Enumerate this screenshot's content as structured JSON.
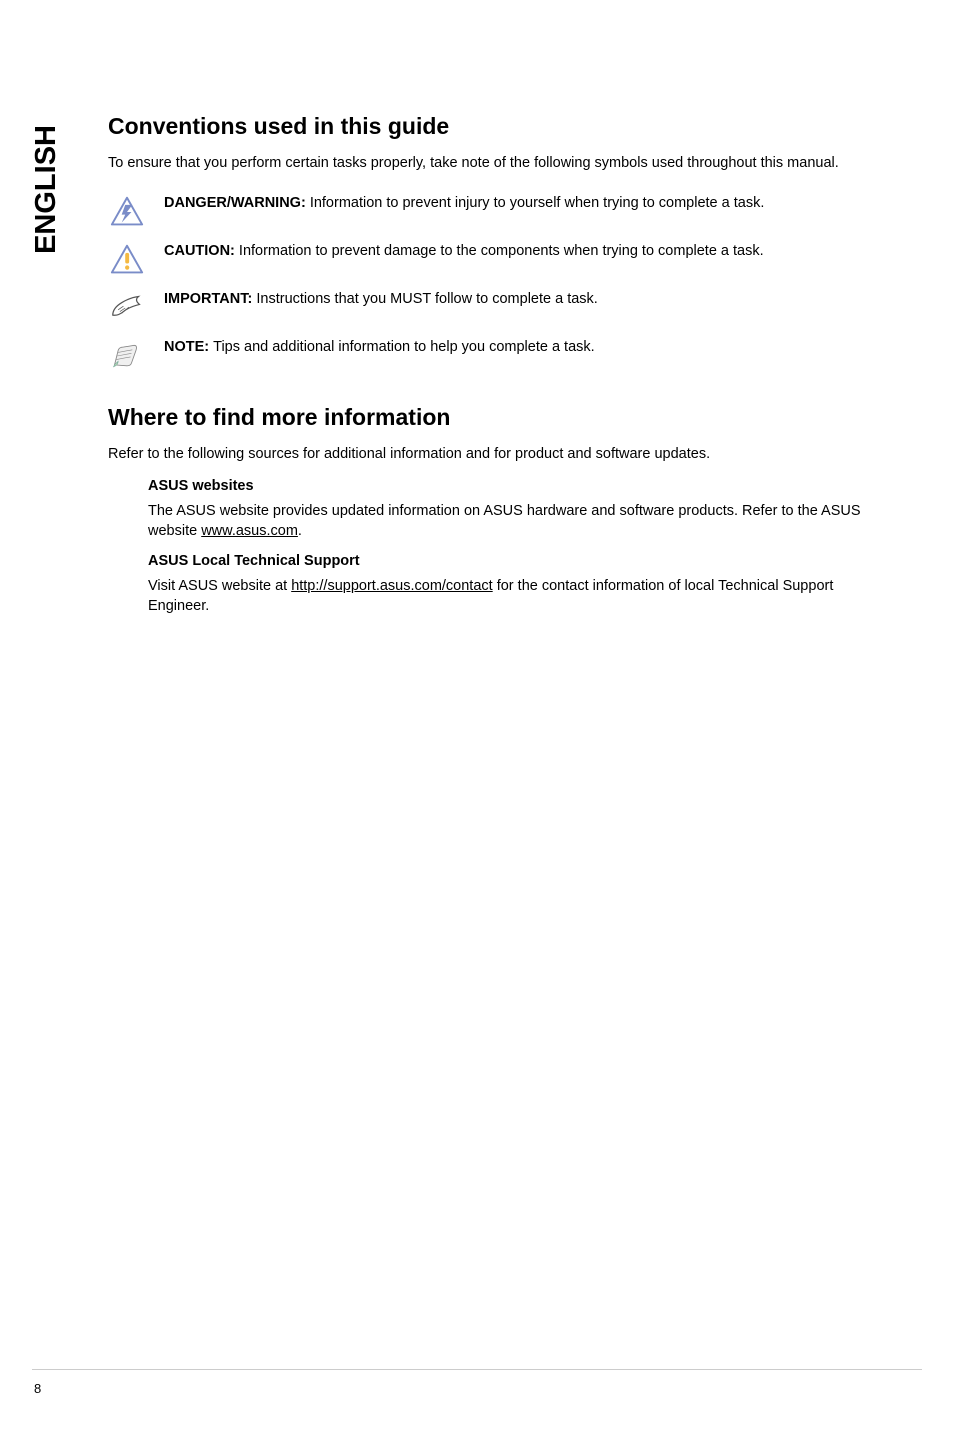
{
  "sidebar": {
    "language": "ENGLISH"
  },
  "section1": {
    "heading": "Conventions used in this guide",
    "intro": "To ensure that you perform certain tasks properly, take note of the following symbols used throughout this manual.",
    "items": [
      {
        "label": "DANGER/WARNING: ",
        "body": "Information to prevent injury to yourself when trying to complete a task."
      },
      {
        "label": "CAUTION: ",
        "body": "Information to prevent damage to the components when trying to complete a task."
      },
      {
        "label": "IMPORTANT: ",
        "body": "Instructions that you MUST follow to complete a task."
      },
      {
        "label": "NOTE: ",
        "body": "Tips and additional information to help you complete a task."
      }
    ]
  },
  "section2": {
    "heading": "Where to find more information",
    "intro": "Refer to the following sources for additional information and for product and software updates.",
    "subs": [
      {
        "title": "ASUS websites",
        "before": "The ASUS website provides updated information on ASUS hardware and software products. Refer to the ASUS website ",
        "link": "www.asus.com",
        "after": "."
      },
      {
        "title": "ASUS Local Technical Support",
        "before": "Visit ASUS website at ",
        "link": "http://support.asus.com/contact",
        "after": " for the contact information of local Technical Support Engineer."
      }
    ]
  },
  "page": {
    "number": "8"
  }
}
